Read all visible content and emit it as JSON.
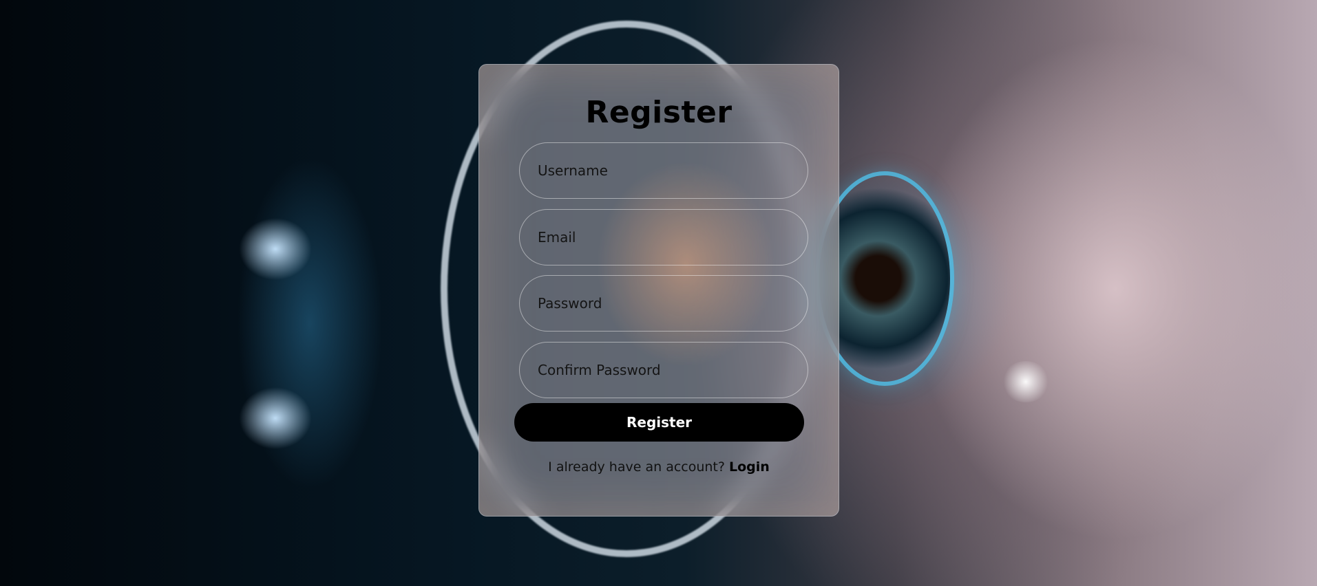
{
  "form": {
    "title": "Register",
    "username_placeholder": "Username",
    "email_placeholder": "Email",
    "password_placeholder": "Password",
    "confirm_password_placeholder": "Confirm Password",
    "register_button": "Register",
    "footer_text": "I already have an account?",
    "login_link": "Login"
  }
}
